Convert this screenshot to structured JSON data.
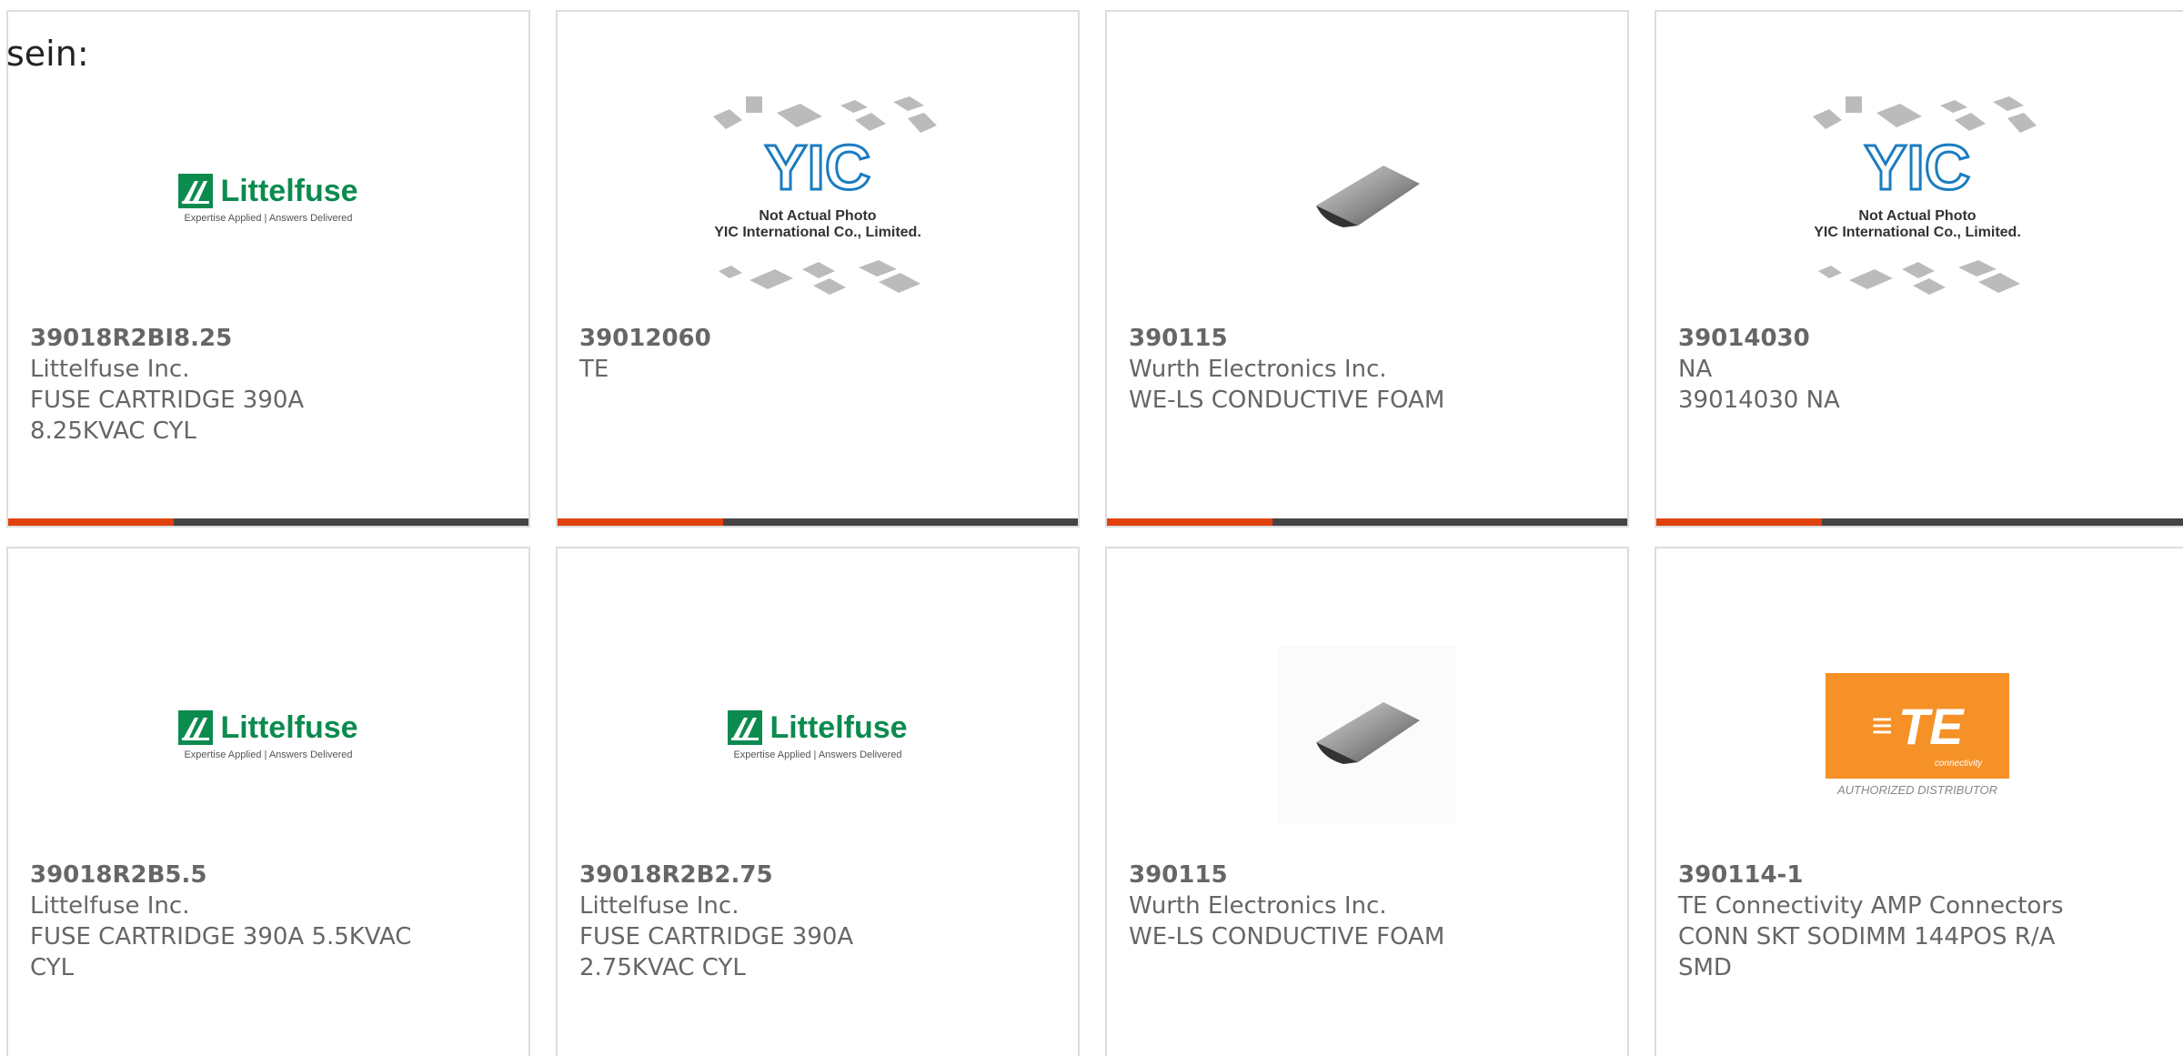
{
  "intro_text": "sein:",
  "products": [
    {
      "part_number": "39018R2BI8.25",
      "manufacturer": "Littelfuse Inc.",
      "description": "FUSE CARTRIDGE 390A",
      "description2": "8.25KVAC CYL",
      "image": "littelfuse-logo",
      "logo_word": "Littelfuse",
      "logo_tagline": "Expertise Applied | Answers Delivered"
    },
    {
      "part_number": "39012060",
      "manufacturer": "TE",
      "description": "",
      "description2": "",
      "image": "yic-placeholder",
      "photo_line1": "Not Actual Photo",
      "photo_line2": "YIC International Co., Limited."
    },
    {
      "part_number": "390115",
      "manufacturer": "Wurth Electronics Inc.",
      "description": "WE-LS CONDUCTIVE FOAM",
      "description2": "",
      "image": "conductive-foam-photo"
    },
    {
      "part_number": "39014030",
      "manufacturer": "NA",
      "description": "39014030 NA",
      "description2": "",
      "image": "yic-placeholder",
      "photo_line1": "Not Actual Photo",
      "photo_line2": "YIC International Co., Limited."
    },
    {
      "part_number": "39018R2B5.5",
      "manufacturer": "Littelfuse Inc.",
      "description": "FUSE CARTRIDGE 390A 5.5KVAC",
      "description2": "CYL",
      "image": "littelfuse-logo",
      "logo_word": "Littelfuse",
      "logo_tagline": "Expertise Applied | Answers Delivered"
    },
    {
      "part_number": "39018R2B2.75",
      "manufacturer": "Littelfuse Inc.",
      "description": "FUSE CARTRIDGE 390A",
      "description2": "2.75KVAC CYL",
      "image": "littelfuse-logo",
      "logo_word": "Littelfuse",
      "logo_tagline": "Expertise Applied | Answers Delivered"
    },
    {
      "part_number": "390115",
      "manufacturer": "Wurth Electronics Inc.",
      "description": "WE-LS CONDUCTIVE FOAM",
      "description2": "",
      "image": "conductive-foam-photo"
    },
    {
      "part_number": "390114-1",
      "manufacturer": "TE Connectivity AMP Connectors",
      "description": "CONN SKT SODIMM 144POS R/A",
      "description2": "SMD",
      "image": "te-logo",
      "logo_word": "TE",
      "logo_sub": "connectivity",
      "logo_caption": "AUTHORIZED DISTRIBUTOR"
    }
  ],
  "colors": {
    "accent_bar": "#e0410f",
    "bar_dark": "#444444",
    "littelfuse_green": "#0c8b4f",
    "te_orange": "#f59127",
    "yic_blue": "#1a7cc1"
  }
}
